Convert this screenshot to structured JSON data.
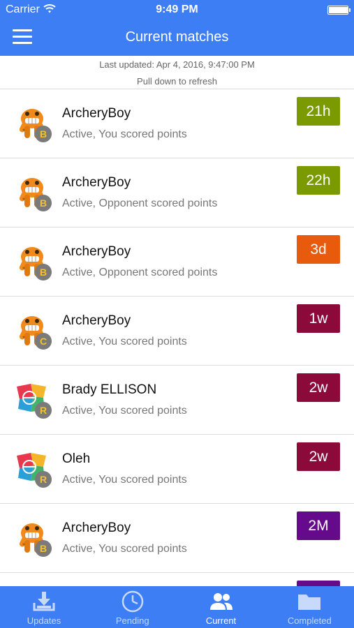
{
  "status_bar": {
    "carrier": "Carrier",
    "time": "9:49 PM",
    "battery_level": 1.0
  },
  "header": {
    "title": "Current matches"
  },
  "refresh": {
    "last_updated": "Last updated: Apr 4, 2016, 9:47:00 PM",
    "hint": "Pull down to refresh"
  },
  "matches": [
    {
      "name": "ArcheryBoy",
      "status": "Active, You scored points",
      "level": "B",
      "age": "21h",
      "age_color": "#7b9a00",
      "avatar": "monster-avatar"
    },
    {
      "name": "ArcheryBoy",
      "status": "Active, Opponent scored points",
      "level": "B",
      "age": "22h",
      "age_color": "#7b9a00",
      "avatar": "monster-avatar"
    },
    {
      "name": "ArcheryBoy",
      "status": "Active, Opponent scored points",
      "level": "B",
      "age": "3d",
      "age_color": "#e85a0c",
      "avatar": "monster-avatar"
    },
    {
      "name": "ArcheryBoy",
      "status": "Active, You scored points",
      "level": "C",
      "age": "1w",
      "age_color": "#8c0a3a",
      "avatar": "monster-avatar"
    },
    {
      "name": "Brady ELLISON",
      "status": "Active, You scored points",
      "level": "R",
      "age": "2w",
      "age_color": "#8c0a3a",
      "avatar": "geometric-avatar"
    },
    {
      "name": "Oleh",
      "status": "Active, You scored points",
      "level": "R",
      "age": "2w",
      "age_color": "#8c0a3a",
      "avatar": "geometric-avatar"
    },
    {
      "name": "ArcheryBoy",
      "status": "Active, You scored points",
      "level": "B",
      "age": "2M",
      "age_color": "#660a8c",
      "avatar": "monster-avatar"
    }
  ],
  "partial_row": {
    "age_color": "#660a8c"
  },
  "tabs": [
    {
      "label": "Updates",
      "icon": "download-tray-icon",
      "active": false
    },
    {
      "label": "Pending",
      "icon": "clock-icon",
      "active": false
    },
    {
      "label": "Current",
      "icon": "people-icon",
      "active": true
    },
    {
      "label": "Completed",
      "icon": "folder-icon",
      "active": false
    }
  ],
  "colors": {
    "accent": "#3d7ef5",
    "tab_inactive": "#c7dafc"
  }
}
